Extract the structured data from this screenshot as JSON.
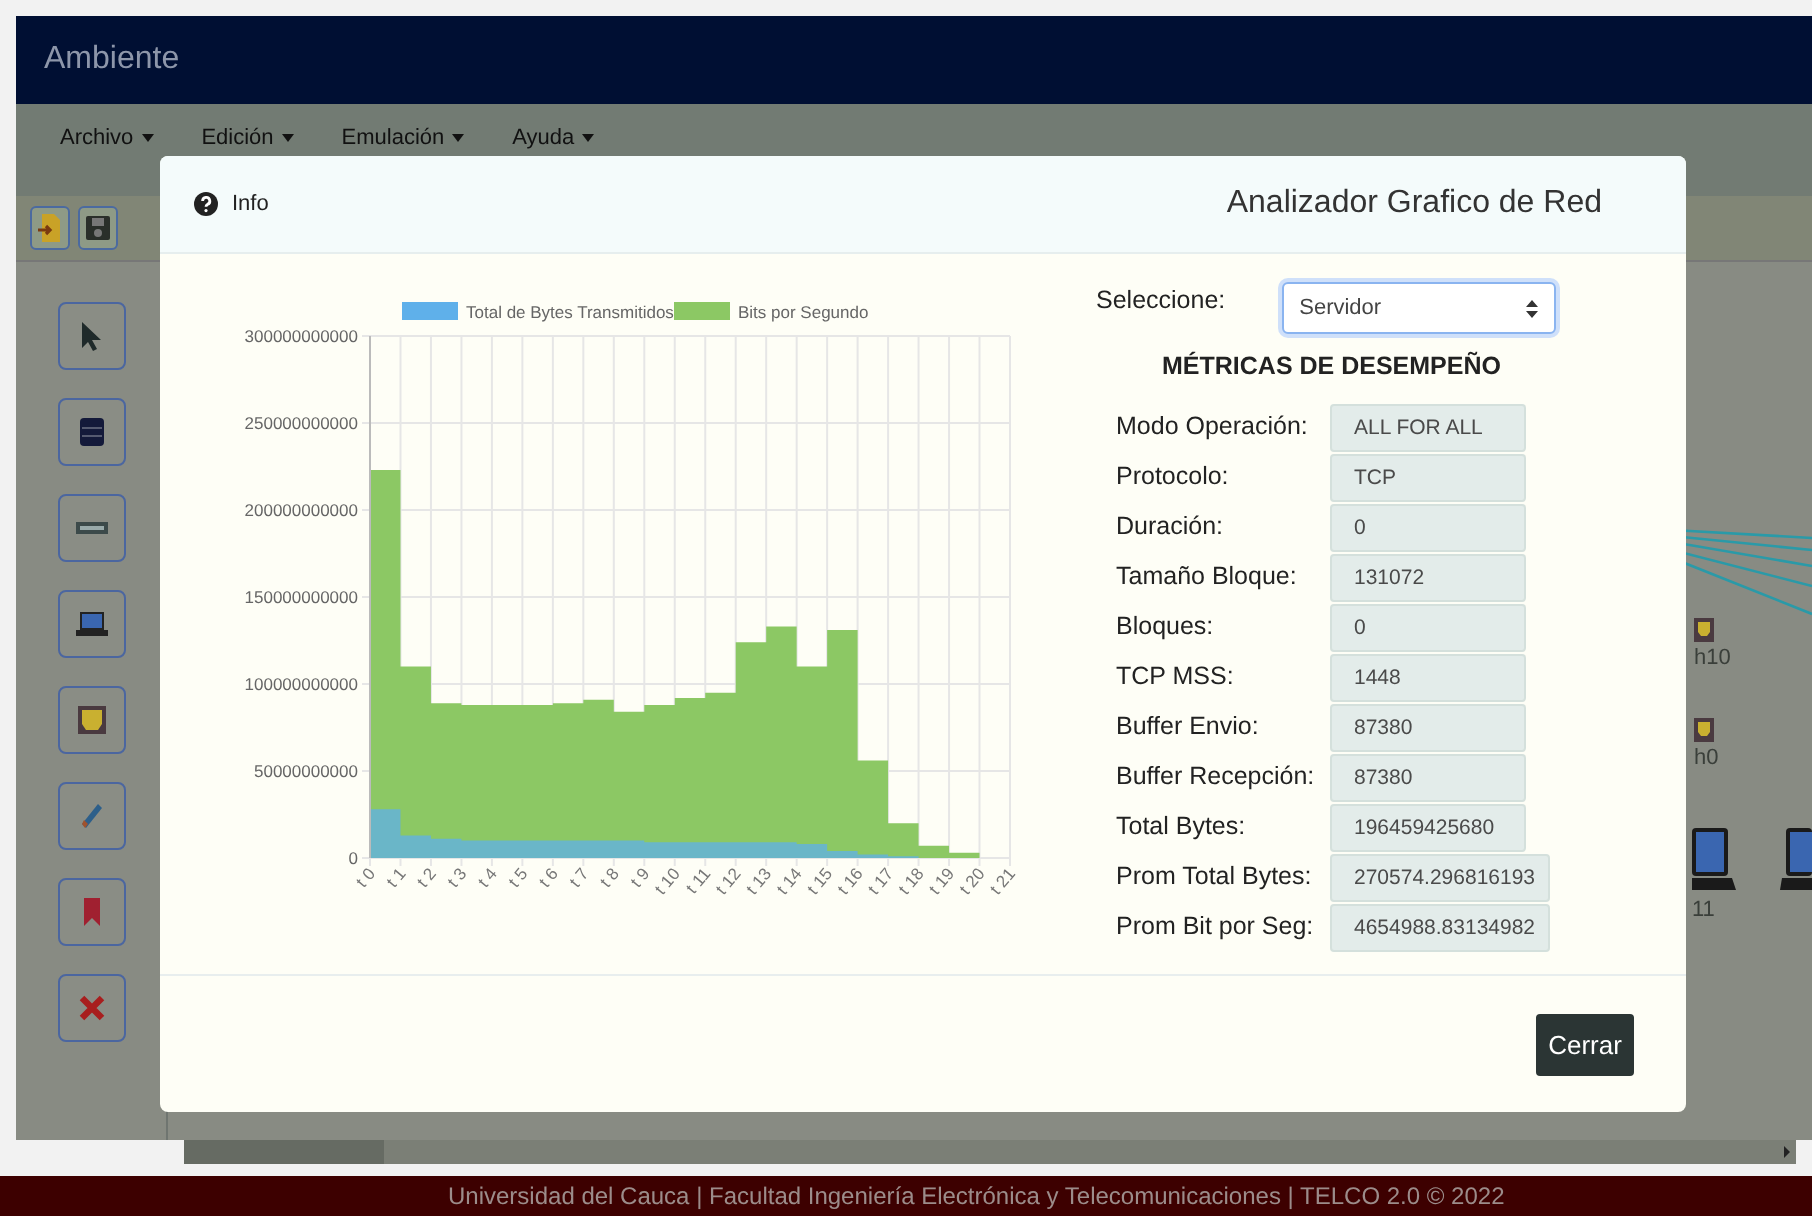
{
  "app": {
    "title": "Ambiente"
  },
  "menu": [
    {
      "label": "Archivo"
    },
    {
      "label": "Edición"
    },
    {
      "label": "Emulación"
    },
    {
      "label": "Ayuda"
    }
  ],
  "canvas": {
    "nodes": [
      {
        "kind": "host",
        "label": "h10"
      },
      {
        "kind": "host",
        "label": "h0"
      },
      {
        "kind": "laptop",
        "label": "11"
      }
    ]
  },
  "dialog": {
    "info": "Info",
    "title": "Analizador Grafico de Red",
    "selector": {
      "label": "Seleccione:",
      "value": "Servidor"
    },
    "heading": "MÉTRICAS DE DESEMPEÑO",
    "metrics": [
      {
        "label": "Modo Operación:",
        "value": "ALL FOR ALL"
      },
      {
        "label": "Protocolo:",
        "value": "TCP"
      },
      {
        "label": "Duración:",
        "value": "0"
      },
      {
        "label": "Tamaño Bloque:",
        "value": "131072"
      },
      {
        "label": "Bloques:",
        "value": "0"
      },
      {
        "label": "TCP MSS:",
        "value": "1448"
      },
      {
        "label": "Buffer Envio:",
        "value": "87380"
      },
      {
        "label": "Buffer Recepción:",
        "value": "87380"
      },
      {
        "label": "Total Bytes:",
        "value": "196459425680"
      },
      {
        "label": "Prom Total Bytes:",
        "value": "270574.296816193"
      },
      {
        "label": "Prom Bit por Seg:",
        "value": "4654988.83134982"
      }
    ],
    "chart_data": {
      "type": "area",
      "grid": true,
      "legend": true,
      "categories": [
        "t 0",
        "t 1",
        "t 2",
        "t 3",
        "t 4",
        "t 5",
        "t 6",
        "t 7",
        "t 8",
        "t 9",
        "t 10",
        "t 11",
        "t 12",
        "t 13",
        "t 14",
        "t 15",
        "t 16",
        "t 17",
        "t 18",
        "t 19",
        "t 20",
        "t 21"
      ],
      "series": [
        {
          "name": "Total de Bytes Transmitidos",
          "color": "#5fb0ea",
          "values": [
            28000000000,
            13000000000,
            11000000000,
            10000000000,
            10000000000,
            10000000000,
            10000000000,
            10000000000,
            10000000000,
            9000000000,
            9000000000,
            9000000000,
            9000000000,
            9000000000,
            8000000000,
            4000000000,
            2000000000,
            1000000000,
            0,
            0,
            0,
            0
          ]
        },
        {
          "name": "Bits por Segundo",
          "color": "#8cc864",
          "values": [
            223000000000,
            110000000000,
            89000000000,
            88000000000,
            88000000000,
            88000000000,
            89000000000,
            91000000000,
            84000000000,
            88000000000,
            92000000000,
            95000000000,
            124000000000,
            133000000000,
            110000000000,
            131000000000,
            56000000000,
            20000000000,
            7000000000,
            3000000000,
            0,
            0
          ]
        }
      ],
      "ylim": [
        0,
        300000000000
      ],
      "yticks": [
        0,
        50000000000,
        100000000000,
        150000000000,
        200000000000,
        250000000000,
        300000000000
      ]
    },
    "close": "Cerrar"
  },
  "footer": "Universidad del Cauca | Facultad Ingeniería Electrónica y Telecomunicaciones | TELCO 2.0 © 2022"
}
